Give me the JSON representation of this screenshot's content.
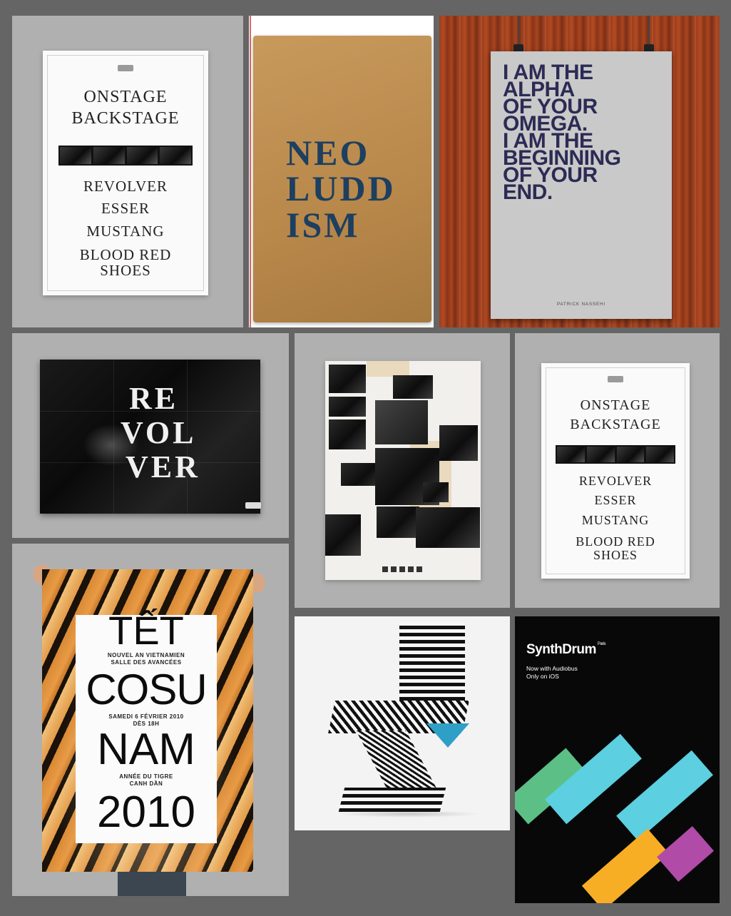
{
  "onstage": {
    "title_1": "ONSTAGE",
    "title_2": "BACKSTAGE",
    "bands": [
      "REVOLVER",
      "ESSER",
      "MUSTANG",
      "BLOOD RED",
      "SHOES"
    ]
  },
  "neo_luddism": {
    "line_1": "NEO",
    "line_2": "LUDD",
    "line_3": "ISM"
  },
  "alpha": {
    "lines": [
      "I AM THE",
      "ALPHA",
      "OF YOUR",
      "OMEGA.",
      "I AM THE",
      "BEGINNING",
      "OF YOUR",
      "END."
    ],
    "credit": "PATRICK NASSEHI"
  },
  "revolver": {
    "lines": [
      "RE",
      "VOL",
      "VER"
    ]
  },
  "tet": {
    "line_1": "TẾT",
    "sub_1a": "NOUVEL AN VIETNAMIEN",
    "sub_1b": "SALLE DES AVANCÉES",
    "line_2": "COSU",
    "sub_2a": "SAMEDI 6 FÉVRIER 2010",
    "sub_2b": "DÈS 18H",
    "line_3": "NAM",
    "sub_3a": "ANNÉE DU TIGRE",
    "sub_3b": "CANH DẦN",
    "line_4": "2010"
  },
  "synthdrum": {
    "title": "SynthDrum",
    "superscript": "Paris",
    "line_1": "Now with Audiobus",
    "line_2": "Only on iOS",
    "colors": {
      "green": "#5cbf86",
      "cyan": "#5ccfe0",
      "orange": "#f7ae24",
      "magenta": "#b04ba8"
    }
  }
}
